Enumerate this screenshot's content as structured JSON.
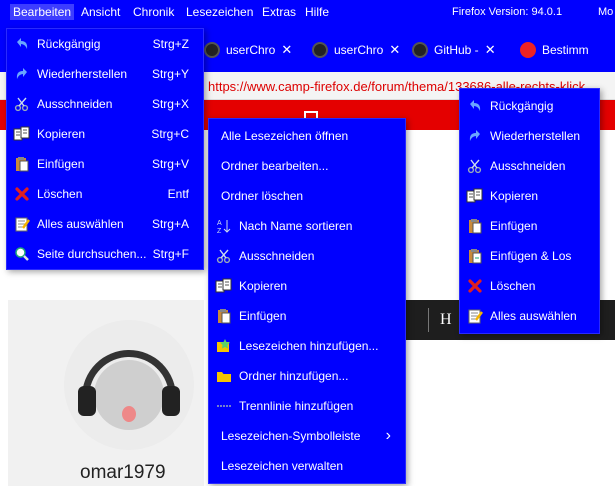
{
  "menubar": {
    "items": [
      "Bearbeiten",
      "Ansicht",
      "Chronik",
      "Lesezeichen",
      "Extras",
      "Hilfe"
    ],
    "firefox_version": "Firefox Version: 94.0.1",
    "overflow_label": "Mo"
  },
  "tabs": [
    {
      "label": "userChro",
      "icon": "github-icon"
    },
    {
      "label": "userChro",
      "icon": "github-icon"
    },
    {
      "label": "GitHub -",
      "icon": "github-icon"
    },
    {
      "label": "Bestimm",
      "icon": "firefox-icon"
    }
  ],
  "url": "https://www.camp-firefox.de/forum/thema/133686-alle-rechts-klick",
  "page": {
    "username": "omar1979",
    "nav_letter": "H"
  },
  "edit_menu": {
    "items": [
      {
        "label": "Rückgängig",
        "accel": "R",
        "shortcut": "Strg+Z",
        "icon": "undo-icon"
      },
      {
        "label": "Wiederherstellen",
        "accel": "W",
        "shortcut": "Strg+Y",
        "icon": "redo-icon"
      },
      {
        "label": "Ausschneiden",
        "accel": "A",
        "shortcut": "Strg+X",
        "icon": "scissors-icon"
      },
      {
        "label": "Kopieren",
        "accel": "K",
        "shortcut": "Strg+C",
        "icon": "copy-icon"
      },
      {
        "label": "Einfügen",
        "accel": "E",
        "shortcut": "Strg+V",
        "icon": "paste-icon"
      },
      {
        "label": "Löschen",
        "accel": "L",
        "shortcut": "Entf",
        "icon": "delete-icon"
      },
      {
        "label": "Alles auswählen",
        "accel": "",
        "shortcut": "Strg+A",
        "icon": "select-all-icon"
      },
      {
        "label": "Seite durchsuchen...",
        "accel": "S",
        "shortcut": "Strg+F",
        "icon": "search-icon"
      }
    ]
  },
  "bookmark_menu": {
    "items": [
      {
        "label": "Alle Lesezeichen öffnen",
        "icon": ""
      },
      {
        "label": "Ordner bearbeiten...",
        "icon": ""
      },
      {
        "label": "Ordner löschen",
        "icon": ""
      },
      {
        "label": "Nach Name sortieren",
        "icon": "sort-icon"
      },
      {
        "label": "Ausschneiden",
        "icon": "scissors-icon"
      },
      {
        "label": "Kopieren",
        "icon": "copy-icon"
      },
      {
        "label": "Einfügen",
        "icon": "paste-icon"
      },
      {
        "label": "Lesezeichen hinzufügen...",
        "icon": "bookmark-add-icon"
      },
      {
        "label": "Ordner hinzufügen...",
        "icon": "folder-icon"
      },
      {
        "label": "Trennlinie hinzufügen",
        "icon": "separator-icon"
      },
      {
        "label": "Lesezeichen-Symbolleiste",
        "icon": "",
        "submenu": true
      },
      {
        "label": "Lesezeichen verwalten",
        "icon": ""
      }
    ]
  },
  "context_menu": {
    "items": [
      {
        "label": "Rückgängig",
        "icon": "undo-icon"
      },
      {
        "label": "Wiederherstellen",
        "icon": "redo-icon"
      },
      {
        "label": "Ausschneiden",
        "icon": "scissors-icon"
      },
      {
        "label": "Kopieren",
        "icon": "copy-icon"
      },
      {
        "label": "Einfügen",
        "icon": "paste-icon"
      },
      {
        "label": "Einfügen & Los",
        "icon": "paste-go-icon"
      },
      {
        "label": "Löschen",
        "icon": "delete-icon"
      },
      {
        "label": "Alles auswählen",
        "icon": "select-all-icon"
      }
    ]
  },
  "colors": {
    "menu_bg": "#0000ff",
    "accent_red": "#e40000",
    "menu_text": "#ffffff"
  }
}
